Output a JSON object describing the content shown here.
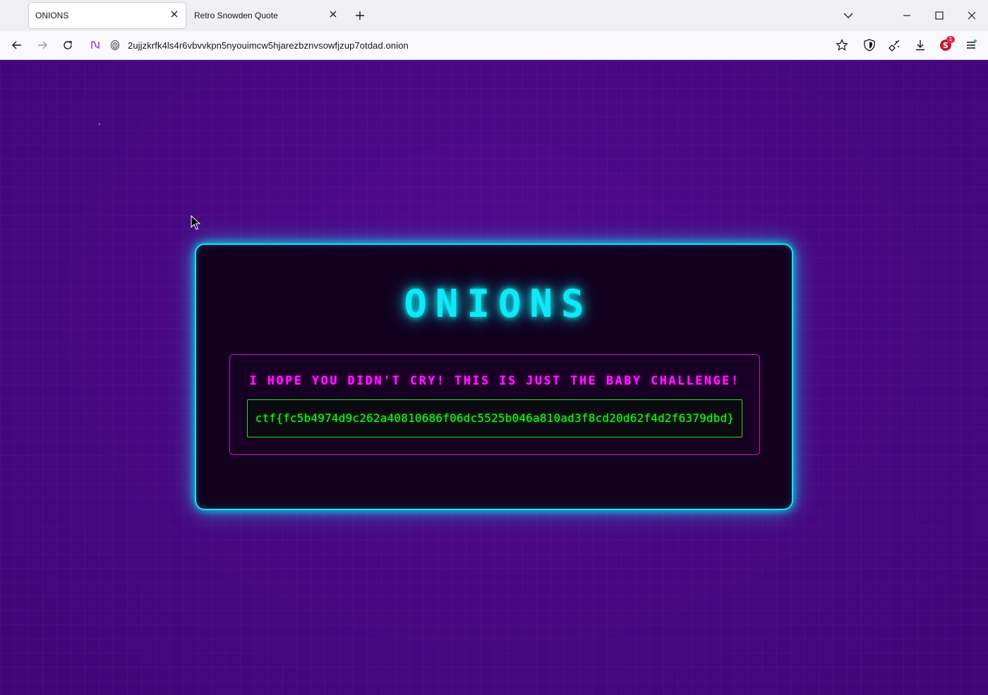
{
  "browser": {
    "tabs": [
      {
        "title": "ONIONS",
        "active": true
      },
      {
        "title": "Retro Snowden Quote",
        "active": false
      }
    ],
    "address_bar": {
      "url": "2ujjzkrfk4ls4r6vbvvkpn5nyouimcw5hjarezbznvsowfjzup7otdad.onion"
    },
    "extension_badge": "1"
  },
  "page": {
    "title": "ONIONS",
    "message": "I HOPE YOU DIDN'T CRY! THIS IS JUST THE BABY CHALLENGE!",
    "flag": "ctf{fc5b4974d9c262a40810686f06dc5525b046a810ad3f8cd20d62f4d2f6379dbd}"
  },
  "colors": {
    "background": "#4b0a85",
    "card_border": "#14e4f4",
    "title": "#10e8f6",
    "message": "#ff1bff",
    "flag": "#25f025"
  }
}
